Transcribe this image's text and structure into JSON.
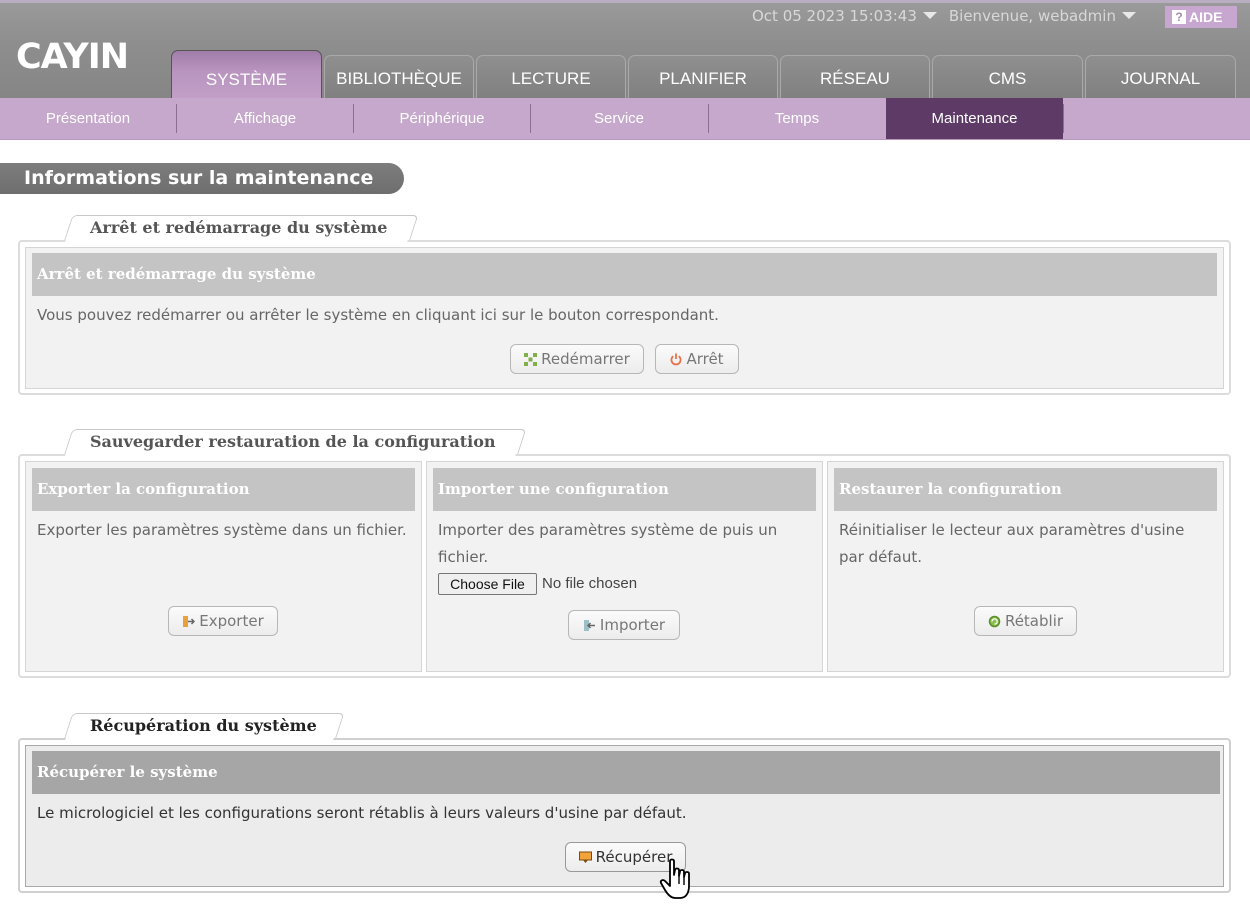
{
  "header": {
    "logo_text": "CAYIN",
    "datetime": "Oct 05 2023 15:03:43",
    "welcome": "Bienvenue, webadmin",
    "help_label": "AIDE",
    "tabs": [
      {
        "label": "SYSTÈME",
        "active": true
      },
      {
        "label": "BIBLIOTHÈQUE"
      },
      {
        "label": "LECTURE"
      },
      {
        "label": "PLANIFIER"
      },
      {
        "label": "RÉSEAU"
      },
      {
        "label": "CMS"
      },
      {
        "label": "JOURNAL"
      }
    ]
  },
  "subnav": {
    "items": [
      {
        "label": "Présentation"
      },
      {
        "label": "Affichage"
      },
      {
        "label": "Périphérique"
      },
      {
        "label": "Service"
      },
      {
        "label": "Temps"
      },
      {
        "label": "Maintenance",
        "active": true
      }
    ]
  },
  "page_title": "Informations sur la maintenance",
  "sections": {
    "shutdown": {
      "tab_label": "Arrêt et redémarrage du système",
      "header": "Arrêt et redémarrage du système",
      "description": "Vous pouvez redémarrer ou arrêter le système en cliquant ici sur le bouton correspondant.",
      "restart_label": "Redémarrer",
      "shutdown_label": "Arrêt"
    },
    "backup": {
      "tab_label": "Sauvegarder restauration de la configuration",
      "export": {
        "header": "Exporter la configuration",
        "description": "Exporter les paramètres système dans un fichier.",
        "button": "Exporter"
      },
      "import": {
        "header": "Importer une configuration",
        "description_line1": "Importer des paramètres système de puis un",
        "description_line2": "fichier.",
        "file_button": "Choose File",
        "file_status": "No file chosen",
        "button": "Importer"
      },
      "restore": {
        "header": "Restaurer la configuration",
        "description_line1": "Réinitialiser le lecteur aux paramètres d'usine",
        "description_line2": "par défaut.",
        "button": "Rétablir"
      }
    },
    "recovery": {
      "tab_label": "Récupération du système",
      "header": "Récupérer le système",
      "description": "Le micrologiciel et les configurations seront rétablis à leurs valeurs d'usine par défaut.",
      "button": "Récupérer"
    }
  },
  "colors": {
    "header_gray": "#8e8e8e",
    "accent_purple": "#c5a8cb",
    "active_subnav": "#5e3a66"
  }
}
